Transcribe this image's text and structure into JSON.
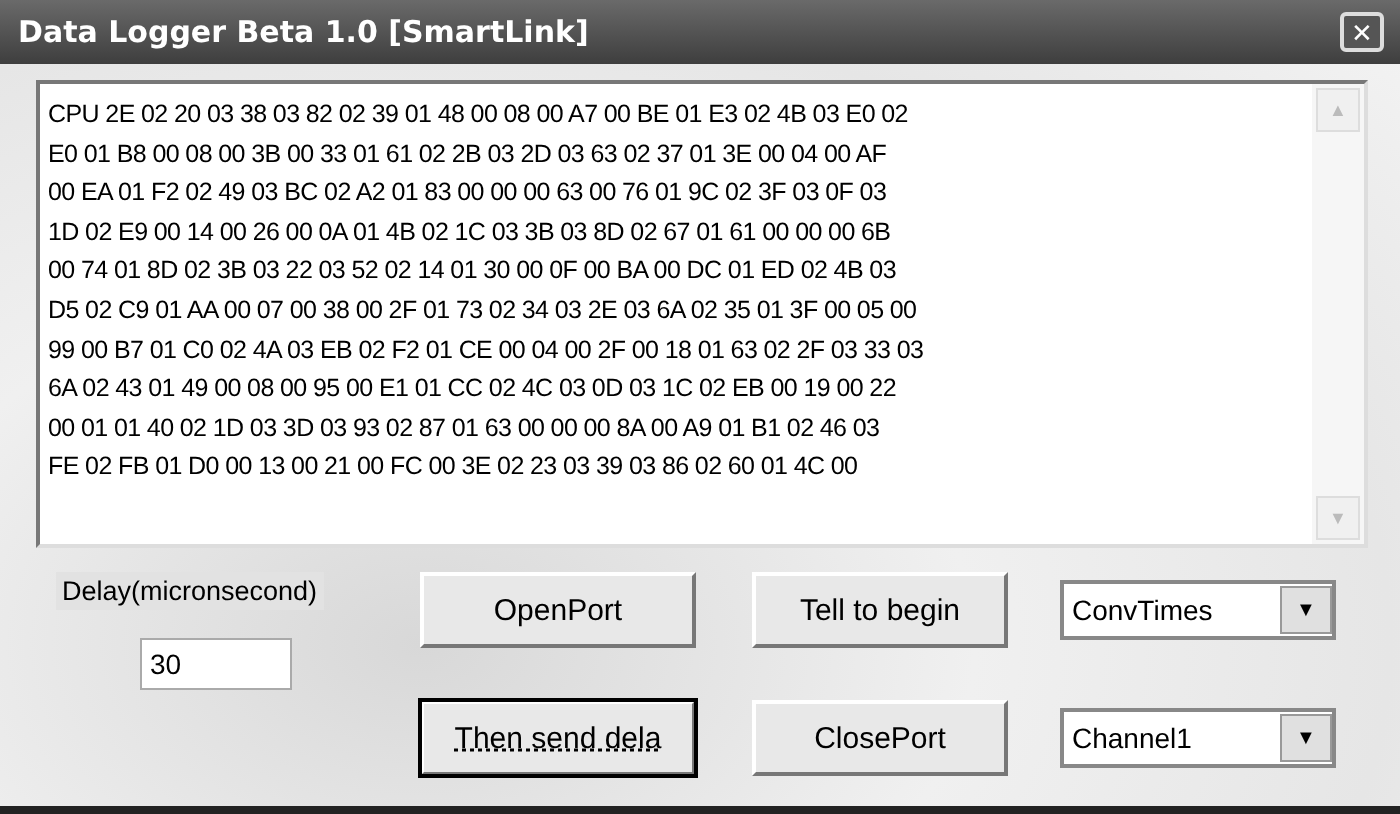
{
  "window": {
    "title": "Data Logger Beta 1.0 [SmartLink]",
    "close_glyph": "✕"
  },
  "log": {
    "lines": [
      "CPU 2E 02 20 03 38 03 82 02 39 01 48 00 08 00 A7 00 BE 01 E3 02 4B 03 E0 02",
      "E0 01 B8 00 08 00 3B 00 33 01 61 02 2B 03 2D 03 63 02 37 01 3E 00 04 00 AF",
      "00 EA 01 F2 02 49 03 BC 02 A2 01 83 00 00 00 63 00 76 01 9C 02 3F 03 0F 03",
      "1D 02 E9 00 14 00 26 00 0A 01 4B 02 1C 03 3B 03 8D 02 67 01 61 00 00 00 6B",
      "00 74 01 8D 02 3B 03 22 03 52 02 14 01 30 00 0F 00 BA 00 DC 01 ED 02 4B 03",
      "D5 02 C9 01 AA 00 07 00 38 00 2F 01 73 02 34 03 2E 03 6A 02 35 01 3F 00 05 00",
      "99 00 B7 01 C0 02 4A 03 EB 02 F2 01 CE 00 04 00 2F 00 18 01 63 02 2F 03 33 03",
      "6A 02 43 01 49 00 08 00 95 00 E1 01 CC 02 4C 03 0D 03 1C 02 EB 00 19 00 22",
      "00 01 01 40 02 1D 03 3D 03 93 02 87 01 63 00 00 00 8A 00 A9 01 B1 02 46 03",
      "FE 02 FB 01 D0 00 13 00 21 00 FC 00 3E 02 23 03 39 03 86 02 60 01 4C 00"
    ],
    "scroll_up": "▲",
    "scroll_down": "▼"
  },
  "delay": {
    "label": "Delay(micronsecond)",
    "value": "30"
  },
  "buttons": [
    {
      "label": "OpenPort",
      "focused": false
    },
    {
      "label": "Tell to begin",
      "focused": false
    },
    {
      "label": "Then send dela",
      "focused": true
    },
    {
      "label": "ClosePort",
      "focused": false
    }
  ],
  "dropdowns": [
    {
      "value": "ConvTimes",
      "arrow": "▼"
    },
    {
      "value": "Channel1",
      "arrow": "▼"
    }
  ]
}
